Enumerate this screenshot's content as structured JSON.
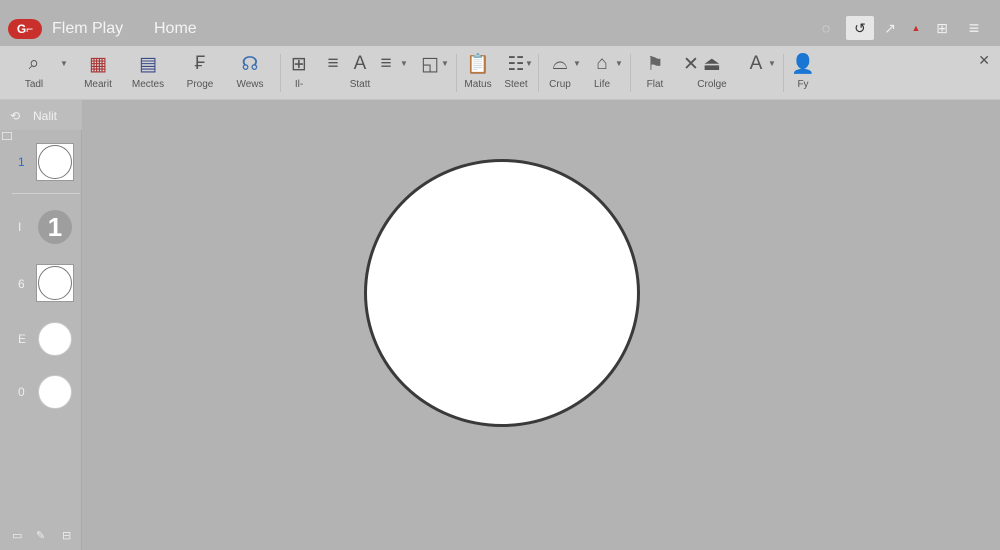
{
  "titlebar": {
    "app_badge": "G⌐",
    "title": "Flem Play",
    "home_tab": "Home",
    "controls": [
      {
        "icon": "refresh-icon",
        "glyph": "◌"
      },
      {
        "icon": "undo-icon",
        "glyph": "↺"
      },
      {
        "icon": "pen-icon",
        "glyph": "↗"
      },
      {
        "icon": "triangle-icon",
        "glyph": "▲"
      },
      {
        "icon": "layout-icon",
        "glyph": "⊞"
      },
      {
        "icon": "menu-icon",
        "glyph": "≡"
      }
    ]
  },
  "ribbon": {
    "tools": [
      {
        "label": "Tadl",
        "icon": "zoom-icon",
        "glyph": "⌕"
      },
      {
        "label": "Mearit",
        "icon": "calendar-icon",
        "glyph": "▦"
      },
      {
        "label": "Mectes",
        "icon": "list-icon",
        "glyph": "▤"
      },
      {
        "label": "Proge",
        "icon": "format-icon",
        "glyph": "₣"
      },
      {
        "label": "Wews",
        "icon": "headset-icon",
        "glyph": "☊"
      },
      {
        "label": "Il-",
        "icon": "grid-icon",
        "glyph": "⊞"
      },
      {
        "label": "",
        "icon": "align-icon",
        "glyph": "≡"
      },
      {
        "label": "Statt",
        "icon": "text-icon",
        "glyph": "A"
      },
      {
        "label": "",
        "icon": "paragraph-icon",
        "glyph": "≡"
      },
      {
        "label": "",
        "icon": "shape-icon",
        "glyph": "◱"
      },
      {
        "label": "Matus",
        "icon": "clipboard-icon",
        "glyph": "📋"
      },
      {
        "label": "Steet",
        "icon": "sheet-icon",
        "glyph": "☷"
      },
      {
        "label": "Crup",
        "icon": "lasso-icon",
        "glyph": "⌓"
      },
      {
        "label": "Life",
        "icon": "home-icon",
        "glyph": "⌂"
      },
      {
        "label": "Flat",
        "icon": "bucket-icon",
        "glyph": "⚑"
      },
      {
        "label": "",
        "icon": "cross-icon",
        "glyph": "✕"
      },
      {
        "label": "Crolge",
        "icon": "stamp-icon",
        "glyph": "⏏"
      },
      {
        "label": "",
        "icon": "font-icon",
        "glyph": "A"
      },
      {
        "label": "Fy",
        "icon": "person-icon",
        "glyph": "👤"
      }
    ],
    "close_glyph": "✕"
  },
  "panel": {
    "header": "Nalit",
    "header_glyph": "⟲",
    "slides": [
      {
        "number": "1"
      },
      {
        "number": "I",
        "thumb_text": "1"
      },
      {
        "number": "6"
      },
      {
        "number": "E"
      },
      {
        "number": "0"
      }
    ],
    "footer_glyphs": [
      "▭",
      "✎",
      "⊟"
    ]
  },
  "colors": {
    "accent": "#1e6fd9",
    "badge": "#c9302c",
    "canvas": "#b3b3b3"
  }
}
